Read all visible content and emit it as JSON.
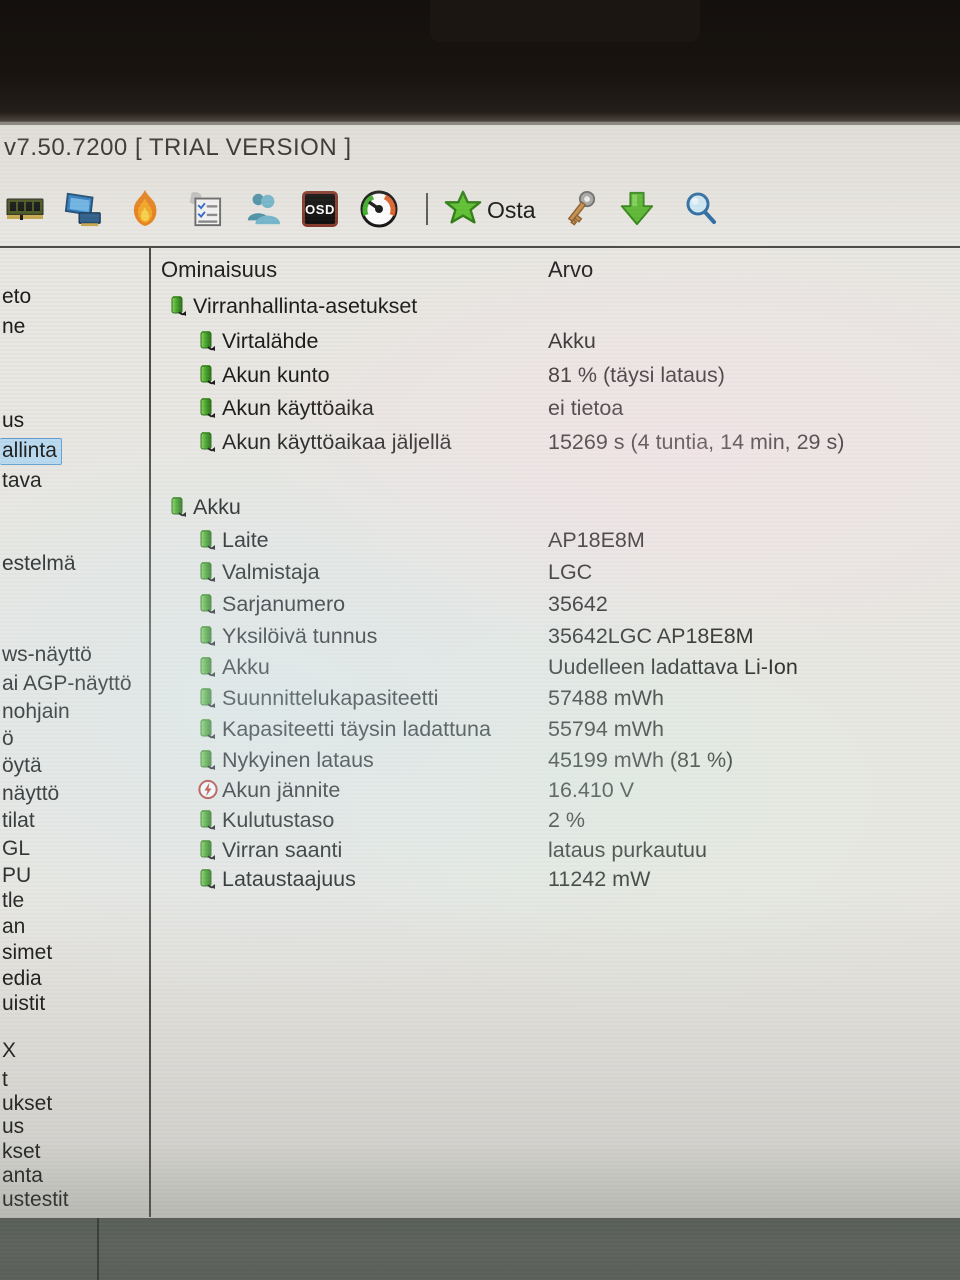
{
  "window": {
    "title": "v7.50.7200  [ TRIAL VERSION ]"
  },
  "toolbar": {
    "buy_label": "Osta",
    "osd_label": "OSD",
    "icons": [
      "memory-module",
      "display-adapter",
      "burn-in",
      "report",
      "user-profiles",
      "osd",
      "sensor-gauge",
      "buy-star",
      "key",
      "download-update",
      "search"
    ]
  },
  "sidebar": {
    "note": "left edge of tree is cropped by photo; only label fragments visible",
    "items": [
      {
        "label": "eto"
      },
      {
        "label": "ne"
      },
      {
        "label": "us"
      },
      {
        "label": "allinta",
        "selected": true
      },
      {
        "label": "tava"
      },
      {
        "label": "estelmä"
      },
      {
        "label": "ws-näyttö"
      },
      {
        "label": "ai AGP-näyttö"
      },
      {
        "label": "nohjain"
      },
      {
        "label": "ö"
      },
      {
        "label": "öytä"
      },
      {
        "label": "näyttö"
      },
      {
        "label": "tilat"
      },
      {
        "label": "GL"
      },
      {
        "label": "PU"
      },
      {
        "label": "tle"
      },
      {
        "label": "an"
      },
      {
        "label": "simet"
      },
      {
        "label": "edia"
      },
      {
        "label": "uistit"
      },
      {
        "label": "X"
      },
      {
        "label": "t"
      },
      {
        "label": "ukset"
      },
      {
        "label": "us"
      },
      {
        "label": "kset"
      },
      {
        "label": "anta"
      },
      {
        "label": "ustestit"
      }
    ]
  },
  "table": {
    "columns": {
      "property": "Ominaisuus",
      "value": "Arvo"
    },
    "sections": [
      {
        "title": "Virranhallinta-asetukset",
        "rows": [
          {
            "label": "Virtalähde",
            "value": "Akku"
          },
          {
            "label": "Akun kunto",
            "value": "81 % (täysi lataus)"
          },
          {
            "label": "Akun käyttöaika",
            "value": "ei tietoa"
          },
          {
            "label": "Akun käyttöaikaa jäljellä",
            "value": "15269 s (4 tuntia, 14 min, 29 s)"
          }
        ]
      },
      {
        "title": "Akku",
        "rows": [
          {
            "label": "Laite",
            "value": "AP18E8M"
          },
          {
            "label": "Valmistaja",
            "value": "LGC"
          },
          {
            "label": "Sarjanumero",
            "value": "35642"
          },
          {
            "label": "Yksilöivä tunnus",
            "value": "35642LGC AP18E8M"
          },
          {
            "label": "Akku",
            "value": "Uudelleen ladattava Li-Ion"
          },
          {
            "label": "Suunnittelukapasiteetti",
            "value": "57488 mWh"
          },
          {
            "label": "Kapasiteetti täysin ladattuna",
            "value": "55794 mWh"
          },
          {
            "label": "Nykyinen lataus",
            "value": "45199 mWh  (81 %)"
          },
          {
            "label": "Akun jännite",
            "value": "16.410 V",
            "icon": "voltage"
          },
          {
            "label": "Kulutustaso",
            "value": "2 %"
          },
          {
            "label": "Virran saanti",
            "value": "lataus purkautuu"
          },
          {
            "label": "Lataustaajuus",
            "value": "11242 mW"
          }
        ]
      }
    ]
  },
  "colors": {
    "selection_bg": "#b9d9f0",
    "selection_border": "#64a0d2",
    "battery_icon_green": "#4aa82e",
    "voltage_icon_red": "#c23127",
    "panel_line": "#4c4a47",
    "bottom_band": "#5c615c"
  }
}
